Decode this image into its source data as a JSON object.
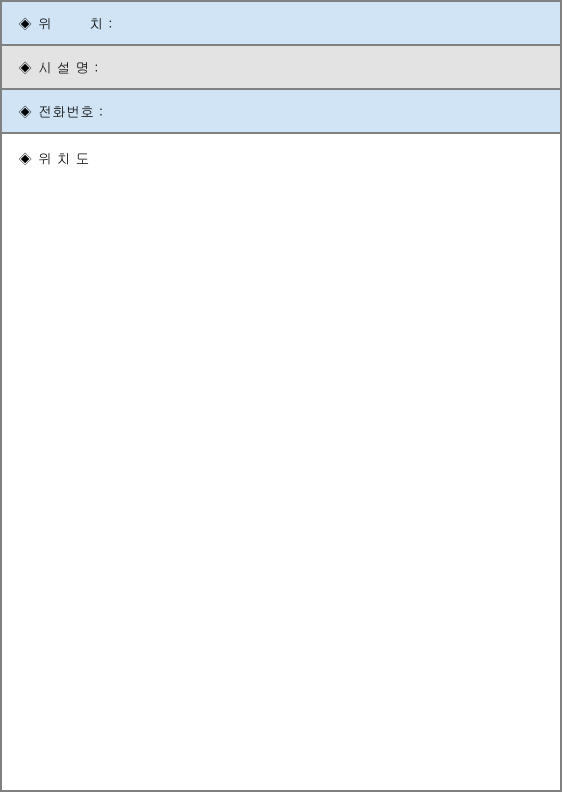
{
  "rows": {
    "location": {
      "bullet": "◈",
      "label": "위        치 :"
    },
    "facility": {
      "bullet": "◈",
      "label": "시 설 명 :"
    },
    "phone": {
      "bullet": "◈",
      "label": "전화번호 :"
    },
    "map": {
      "bullet": "◈",
      "label": "위 치 도"
    }
  }
}
